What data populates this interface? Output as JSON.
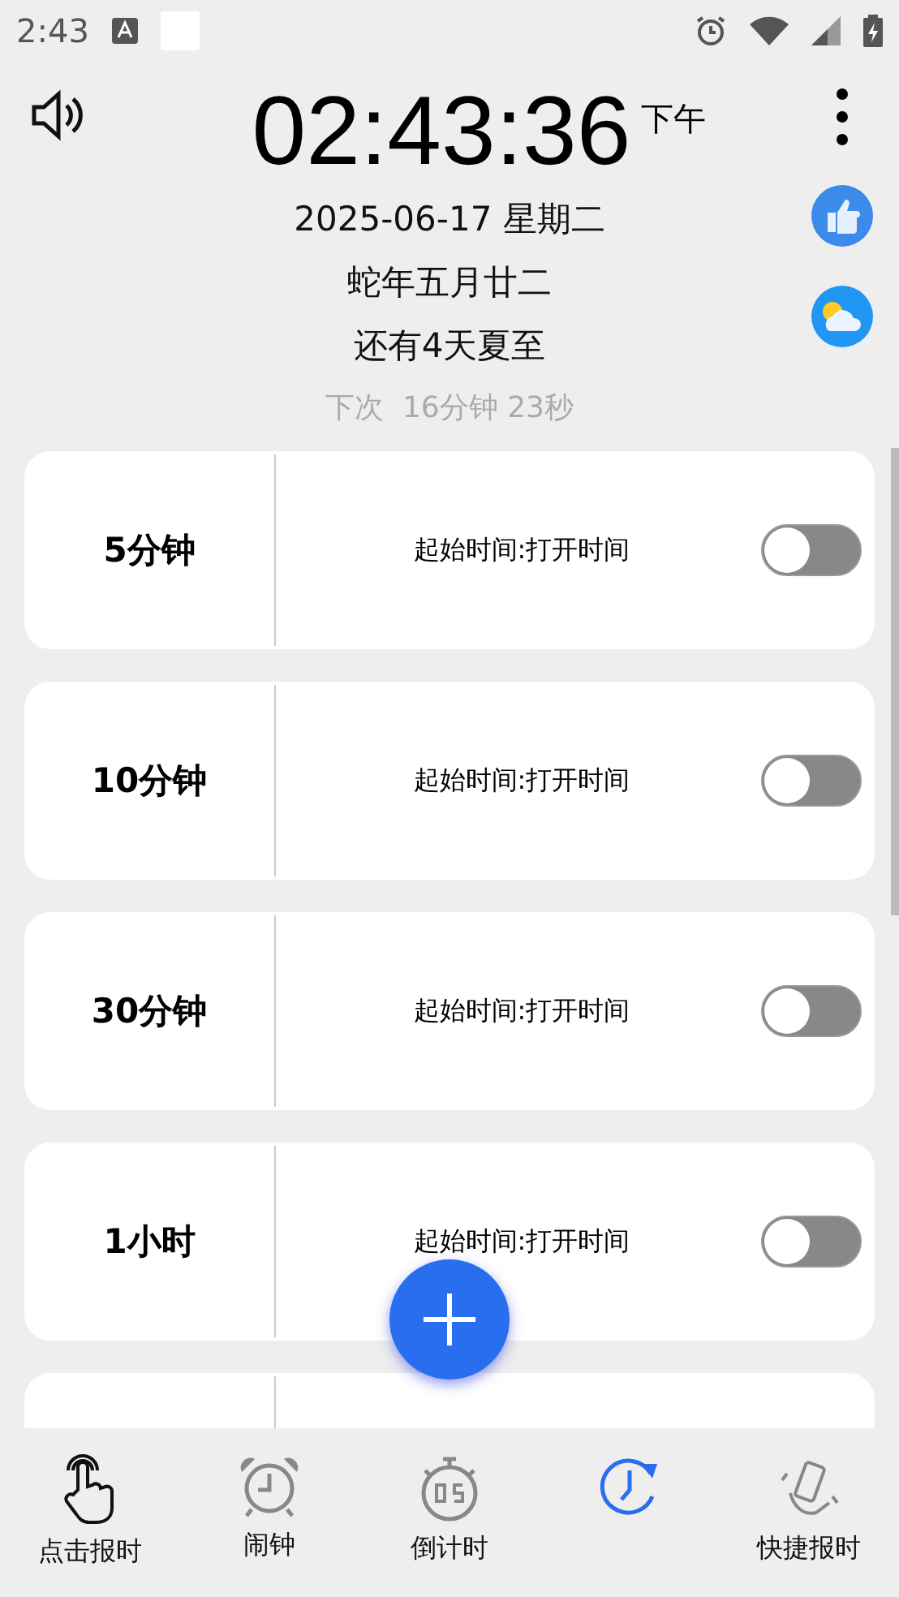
{
  "status_bar": {
    "time": "2:43"
  },
  "header": {
    "clock": "02:43:36",
    "meridiem": "下午",
    "date": "2025-06-17 星期二",
    "lunar": "蛇年五月廿二",
    "solar_term": "还有4天夏至",
    "next": "下次  16分钟 23秒"
  },
  "intervals": [
    {
      "label": "5分钟",
      "subtitle": "起始时间:打开时间",
      "on": false
    },
    {
      "label": "10分钟",
      "subtitle": "起始时间:打开时间",
      "on": false
    },
    {
      "label": "30分钟",
      "subtitle": "起始时间:打开时间",
      "on": false
    },
    {
      "label": "1小时",
      "subtitle": "起始时间:打开时间",
      "on": false
    }
  ],
  "bottom_nav": [
    {
      "kind": "tap",
      "label": "点击报时",
      "selected": false
    },
    {
      "kind": "alarm",
      "label": "闹钟",
      "selected": false
    },
    {
      "kind": "countdown",
      "label": "倒计时",
      "selected": false
    },
    {
      "kind": "interval",
      "selected": true
    },
    {
      "kind": "shake",
      "label": "快捷报时",
      "selected": false
    }
  ]
}
